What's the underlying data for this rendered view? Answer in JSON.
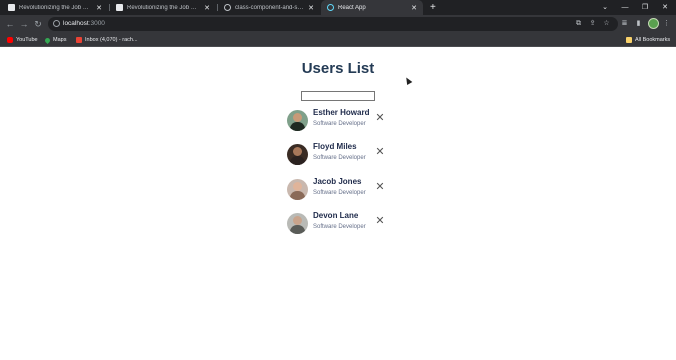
{
  "browser": {
    "tabs": [
      {
        "title": "Revolutionizing the Job Market |",
        "icon": "doc-icon",
        "active": false
      },
      {
        "title": "Revolutionizing the Job Market |",
        "icon": "doc-icon",
        "active": false
      },
      {
        "title": "class-component-and-state-2 -",
        "icon": "globe-icon",
        "active": false
      },
      {
        "title": "React App",
        "icon": "react-icon",
        "active": true
      }
    ],
    "new_tab_symbol": "+",
    "url_host": "localhost",
    "url_port": ":3000",
    "bookmarks": [
      {
        "label": "YouTube",
        "icon": "youtube-icon"
      },
      {
        "label": "Maps",
        "icon": "maps-icon"
      },
      {
        "label": "Inbox (4,070) - rach...",
        "icon": "gmail-icon"
      }
    ],
    "all_bookmarks": "All Bookmarks"
  },
  "app": {
    "title": "Users List",
    "search": {
      "value": "",
      "placeholder": ""
    },
    "users": [
      {
        "name": "Esther Howard",
        "role": "Software Developer",
        "remove": "✕"
      },
      {
        "name": "Floyd Miles",
        "role": "Software Developer",
        "remove": "✕"
      },
      {
        "name": "Jacob Jones",
        "role": "Software Developer",
        "remove": "✕"
      },
      {
        "name": "Devon Lane",
        "role": "Software Developer",
        "remove": "✕"
      }
    ]
  },
  "colors": {
    "heading": "#243b55",
    "name": "#1e2a4a",
    "role": "#66708a",
    "chrome_dark": "#202124",
    "chrome_toolbar": "#35363a"
  }
}
